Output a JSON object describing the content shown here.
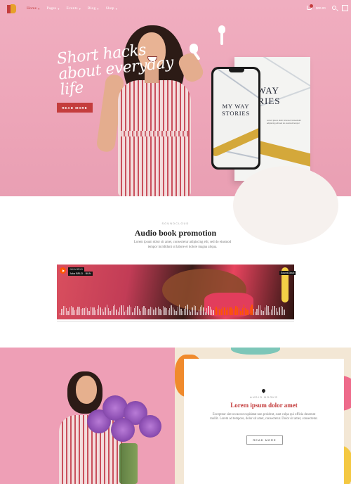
{
  "header": {
    "nav": [
      {
        "label": "Home",
        "active": true
      },
      {
        "label": "Pages",
        "active": false
      },
      {
        "label": "Events",
        "active": false
      },
      {
        "label": "Blog",
        "active": false
      },
      {
        "label": "Shop",
        "active": false
      }
    ],
    "cart_amount": "$00.00",
    "icons": [
      "logo-icon",
      "cart-icon",
      "search-icon",
      "menu-icon"
    ]
  },
  "hero": {
    "headline": "Short hacks about everyday life",
    "button_label": "READ MORE",
    "book_title": "MY WAY STORIES",
    "phone_title": "MY WAY STORIES"
  },
  "promo": {
    "eyebrow": "SOUNDCLOUD",
    "title": "Audio book promotion",
    "description": "Lorem ipsum dolor sit amet, consectetur adipiscing elit, sed do eiusmod tempor incididunt ut labore et dolore magna aliqua.",
    "player": {
      "artist": "JUKA BRLD",
      "track": "Juka BRLD - BUN",
      "logo": "SoundCloud"
    }
  },
  "feature": {
    "eyebrow": "AUDIO BOOKS",
    "title": "Lorem ipsum dolor amet",
    "description": "Excepteur sint occaecat cupidatat non proident, sunt culpa qui officia deserunt mollit. Lorem ad tempore, dolor sit amet, consectetur. Dolor sit amet, consectetur.",
    "button_label": "READ MORE"
  },
  "colors": {
    "accent": "#c43d3d",
    "hero_pink": "#eda5b8",
    "soundcloud_orange": "#ff5500"
  }
}
